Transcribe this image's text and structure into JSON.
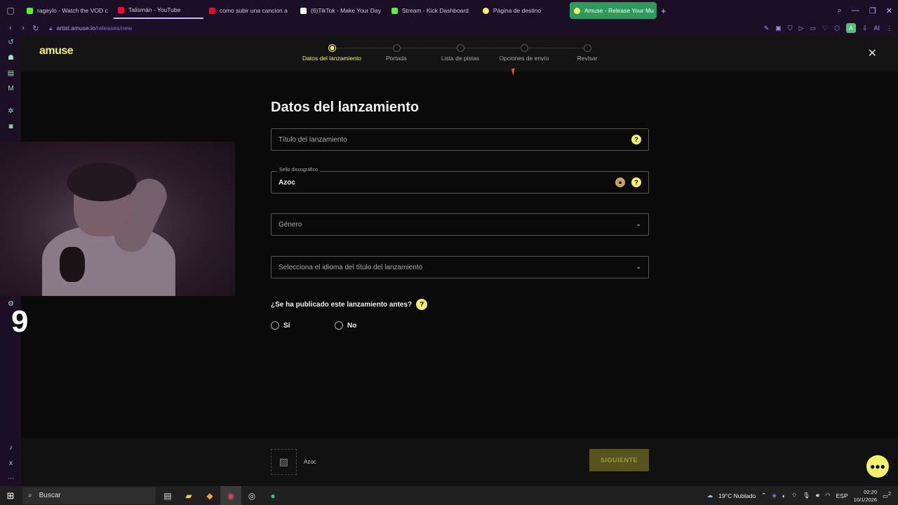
{
  "browser": {
    "tabs": [
      {
        "label": "rageylo - Watch the VOD c",
        "color": "#53fc18"
      },
      {
        "label": "Talismán - YouTube",
        "color": "#ff0033"
      },
      {
        "label": "como subir una cancion a",
        "color": "#ff0033"
      },
      {
        "label": "(6)TikTok - Make Your Day",
        "color": "#ffffff"
      },
      {
        "label": "Stream - Kick Dashboard",
        "color": "#53fc18"
      },
      {
        "label": "Página de destino",
        "color": "#f4f06a"
      },
      {
        "label": "Amuse - Release Your Mu",
        "color": "#f4f06a"
      }
    ],
    "url_host": "artist.amuse.io",
    "url_path": "/releases/new",
    "profile_initial": "A",
    "ai_label": "AI"
  },
  "app": {
    "logo": "amuse",
    "steps": [
      {
        "label": "Datos del lanzamiento",
        "active": true
      },
      {
        "label": "Portada",
        "active": false
      },
      {
        "label": "Lista de pistas",
        "active": false
      },
      {
        "label": "Opciones de envío",
        "active": false
      },
      {
        "label": "Revisar",
        "active": false
      }
    ]
  },
  "form": {
    "title": "Datos del lanzamiento",
    "release_title_placeholder": "Título del lanzamiento",
    "label_legend": "Sello discográfico",
    "label_value": "Azoc",
    "genre_placeholder": "Género",
    "language_placeholder": "Selecciona el idioma del título del lanzamiento",
    "published_question": "¿Se ha publicado este lanzamiento antes?",
    "option_yes": "Sí",
    "option_no": "No"
  },
  "overlay": {
    "counter": "9"
  },
  "footer": {
    "release_name": "Azoc",
    "next_label": "SIGUIENTE"
  },
  "taskbar": {
    "search_label": "Buscar",
    "weather": "19°C  Nublado",
    "language": "ESP",
    "time": "02:20",
    "date": "10/1/2026",
    "notification_count": "2"
  },
  "colors": {
    "accent": "#f4f06a",
    "browser_chrome": "#1a0f24"
  }
}
